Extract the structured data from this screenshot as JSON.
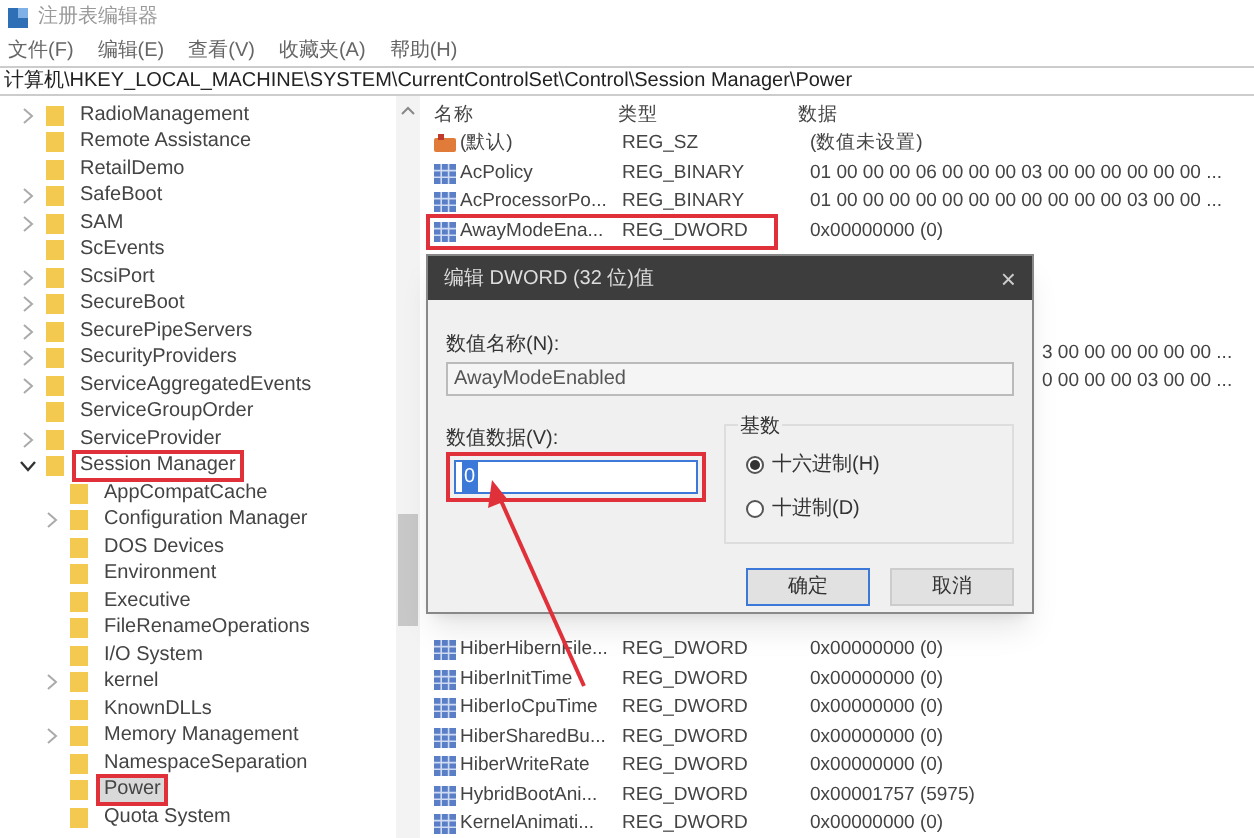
{
  "window": {
    "title": "注册表编辑器"
  },
  "menu": [
    "文件(F)",
    "编辑(E)",
    "查看(V)",
    "收藏夹(A)",
    "帮助(H)"
  ],
  "address": "计算机\\HKEY_LOCAL_MACHINE\\SYSTEM\\CurrentControlSet\\Control\\Session Manager\\Power",
  "tree": [
    {
      "label": "RadioManagement",
      "kind": "branch",
      "expanded": false,
      "selected": false,
      "highlighted": false
    },
    {
      "label": "Remote Assistance",
      "kind": "leaf",
      "selected": false,
      "highlighted": false
    },
    {
      "label": "RetailDemo",
      "kind": "leaf",
      "selected": false,
      "highlighted": false
    },
    {
      "label": "SafeBoot",
      "kind": "branch",
      "expanded": false,
      "selected": false,
      "highlighted": false
    },
    {
      "label": "SAM",
      "kind": "branch",
      "expanded": false,
      "selected": false,
      "highlighted": false
    },
    {
      "label": "ScEvents",
      "kind": "leaf",
      "selected": false,
      "highlighted": false
    },
    {
      "label": "ScsiPort",
      "kind": "branch",
      "expanded": false,
      "selected": false,
      "highlighted": false
    },
    {
      "label": "SecureBoot",
      "kind": "branch",
      "expanded": false,
      "selected": false,
      "highlighted": false
    },
    {
      "label": "SecurePipeServers",
      "kind": "branch",
      "expanded": false,
      "selected": false,
      "highlighted": false
    },
    {
      "label": "SecurityProviders",
      "kind": "branch",
      "expanded": false,
      "selected": false,
      "highlighted": false
    },
    {
      "label": "ServiceAggregatedEvents",
      "kind": "branch",
      "expanded": false,
      "selected": false,
      "highlighted": false
    },
    {
      "label": "ServiceGroupOrder",
      "kind": "leaf",
      "selected": false,
      "highlighted": false
    },
    {
      "label": "ServiceProvider",
      "kind": "branch",
      "expanded": false,
      "selected": false,
      "highlighted": false
    },
    {
      "label": "Session Manager",
      "kind": "branch",
      "expanded": true,
      "selected": false,
      "highlighted": true,
      "children": [
        {
          "label": "AppCompatCache",
          "kind": "leaf",
          "selected": false,
          "highlighted": false
        },
        {
          "label": "Configuration Manager",
          "kind": "branch",
          "expanded": false,
          "selected": false,
          "highlighted": false
        },
        {
          "label": "DOS Devices",
          "kind": "leaf",
          "selected": false,
          "highlighted": false
        },
        {
          "label": "Environment",
          "kind": "leaf",
          "selected": false,
          "highlighted": false
        },
        {
          "label": "Executive",
          "kind": "leaf",
          "selected": false,
          "highlighted": false
        },
        {
          "label": "FileRenameOperations",
          "kind": "leaf",
          "selected": false,
          "highlighted": false
        },
        {
          "label": "I/O System",
          "kind": "leaf",
          "selected": false,
          "highlighted": false
        },
        {
          "label": "kernel",
          "kind": "branch",
          "expanded": false,
          "selected": false,
          "highlighted": false
        },
        {
          "label": "KnownDLLs",
          "kind": "leaf",
          "selected": false,
          "highlighted": false
        },
        {
          "label": "Memory Management",
          "kind": "branch",
          "expanded": false,
          "selected": false,
          "highlighted": false
        },
        {
          "label": "NamespaceSeparation",
          "kind": "leaf",
          "selected": false,
          "highlighted": false
        },
        {
          "label": "Power",
          "kind": "leaf",
          "selected": true,
          "highlighted": true
        },
        {
          "label": "Quota System",
          "kind": "leaf",
          "selected": false,
          "highlighted": false
        }
      ]
    }
  ],
  "columns": [
    "名称",
    "类型",
    "数据"
  ],
  "values_top": [
    {
      "name": "(默认)",
      "type": "REG_SZ",
      "data": "(数值未设置)",
      "kind": "string",
      "highlighted": false
    },
    {
      "name": "AcPolicy",
      "type": "REG_BINARY",
      "data": "01 00 00 00 06 00 00 00 03 00 00 00 00 00 00 ...",
      "kind": "binary",
      "highlighted": false
    },
    {
      "name": "AcProcessorPo...",
      "type": "REG_BINARY",
      "data": "01 00 00 00 00 00 00 00 00 00 00 00 03 00 00 ...",
      "kind": "binary",
      "highlighted": false
    },
    {
      "name": "AwayModeEna...",
      "type": "REG_DWORD",
      "data": "0x00000000 (0)",
      "kind": "dword",
      "highlighted": true
    }
  ],
  "obscured_data_tails": [
    "3 00 00 00 00 00 00 ...",
    "0 00 00 00 03 00 00 ..."
  ],
  "values_bottom": [
    {
      "name": "HiberHibernFile...",
      "type": "REG_DWORD",
      "data": "0x00000000 (0)",
      "kind": "dword",
      "highlighted": false
    },
    {
      "name": "HiberInitTime",
      "type": "REG_DWORD",
      "data": "0x00000000 (0)",
      "kind": "dword",
      "highlighted": false
    },
    {
      "name": "HiberIoCpuTime",
      "type": "REG_DWORD",
      "data": "0x00000000 (0)",
      "kind": "dword",
      "highlighted": false
    },
    {
      "name": "HiberSharedBu...",
      "type": "REG_DWORD",
      "data": "0x00000000 (0)",
      "kind": "dword",
      "highlighted": false
    },
    {
      "name": "HiberWriteRate",
      "type": "REG_DWORD",
      "data": "0x00000000 (0)",
      "kind": "dword",
      "highlighted": false
    },
    {
      "name": "HybridBootAni...",
      "type": "REG_DWORD",
      "data": "0x00001757 (5975)",
      "kind": "dword",
      "highlighted": false
    },
    {
      "name": "KernelAnimati...",
      "type": "REG_DWORD",
      "data": "0x00000000 (0)",
      "kind": "dword",
      "highlighted": false
    }
  ],
  "dialog": {
    "title": "编辑 DWORD (32 位)值",
    "close": "×",
    "name_label": "数值名称(N):",
    "name_value": "AwayModeEnabled",
    "data_label": "数值数据(V):",
    "data_value": "0",
    "data_highlighted": true,
    "base_label": "基数",
    "radios": [
      {
        "label": "十六进制(H)",
        "selected": true
      },
      {
        "label": "十进制(D)",
        "selected": false
      }
    ],
    "buttons": [
      {
        "label": "确定",
        "default": true
      },
      {
        "label": "取消",
        "default": false
      }
    ]
  },
  "annotation": {
    "arrow": true
  }
}
